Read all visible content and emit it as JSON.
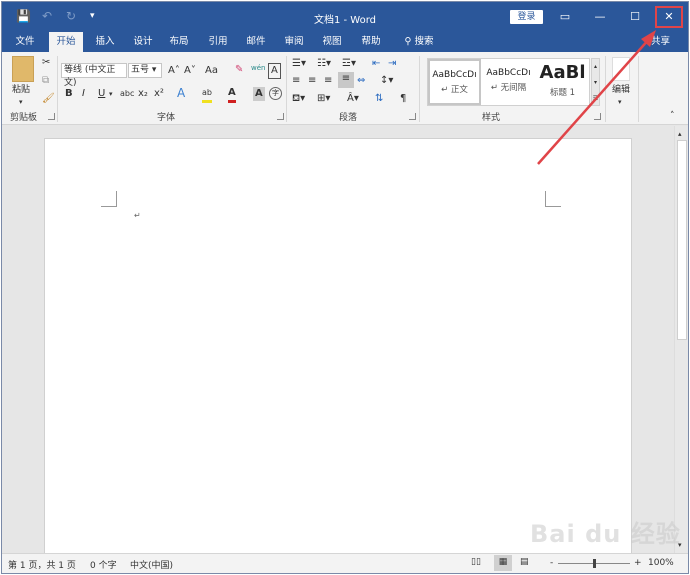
{
  "titlebar": {
    "title": "文档1 - Word",
    "login_label": "登录",
    "quick_access": {
      "save": "💾",
      "undo": "↶",
      "redo": "↻",
      "customize": "▾"
    },
    "controls": {
      "ribbon_display": "▭",
      "minimize": "—",
      "maximize": "☐",
      "close": "✕"
    }
  },
  "tabs": [
    {
      "label": "文件"
    },
    {
      "label": "开始",
      "active": true
    },
    {
      "label": "插入"
    },
    {
      "label": "设计"
    },
    {
      "label": "布局"
    },
    {
      "label": "引用"
    },
    {
      "label": "邮件"
    },
    {
      "label": "审阅"
    },
    {
      "label": "视图"
    },
    {
      "label": "帮助"
    },
    {
      "label": "搜索"
    }
  ],
  "share_label": "共享",
  "ribbon": {
    "clipboard": {
      "label": "剪贴板",
      "paste_label": "粘贴"
    },
    "font": {
      "label": "字体",
      "font_name": "等线 (中文正文)",
      "font_size": "五号",
      "grow": "A˄",
      "shrink": "A˅",
      "case": "Aa",
      "bold": "B",
      "italic": "I",
      "underline": "U",
      "strike": "abc",
      "sub": "x₂",
      "sup": "x²",
      "effects": "A",
      "highlight": "ab",
      "color": "A",
      "shade": "A",
      "enclose": "字",
      "phonetic": "wén",
      "border_char": "A"
    },
    "paragraph": {
      "label": "段落"
    },
    "styles": {
      "label": "样式",
      "items": [
        {
          "preview": "AaBbCcDı",
          "name": "↵ 正文"
        },
        {
          "preview": "AaBbCcDı",
          "name": "↵ 无间隔"
        },
        {
          "preview": "AaBl",
          "name": "标题 1"
        }
      ]
    },
    "editing": {
      "label": "编辑"
    }
  },
  "status": {
    "page": "第 1 页，共 1 页",
    "words": "0 个字",
    "language": "中文(中国)",
    "zoom": "100%",
    "zoom_minus": "-",
    "zoom_plus": "+"
  },
  "watermark": "Bai du 经验",
  "annotation_color": "#e04448",
  "accent_color": "#2b579a"
}
